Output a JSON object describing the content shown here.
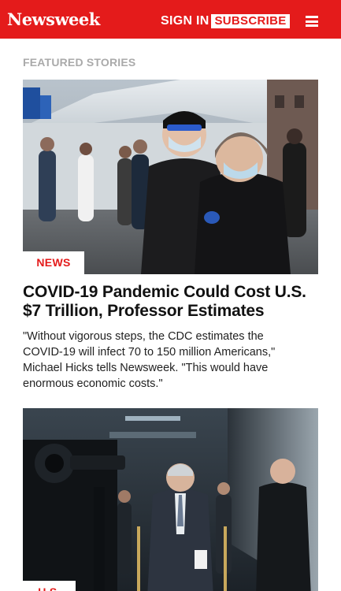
{
  "header": {
    "logo": "Newsweek",
    "sign_in": "SIGN IN",
    "subscribe": "SUBSCRIBE",
    "menu_icon": "hamburger-menu-icon",
    "brand_color": "#e41b1b"
  },
  "section": {
    "title": "FEATURED STORIES"
  },
  "stories": [
    {
      "category": "NEWS",
      "headline": "COVID-19 Pandemic Could Cost U.S. $7 Trillion, Professor Estimates",
      "dek": "\"Without vigorous steps, the CDC estimates the COVID-19 will infect 70 to 150 million Americans,\" Michael Hicks tells Newsweek. \"This would have enormous economic costs.\""
    },
    {
      "category": "U.S."
    }
  ]
}
